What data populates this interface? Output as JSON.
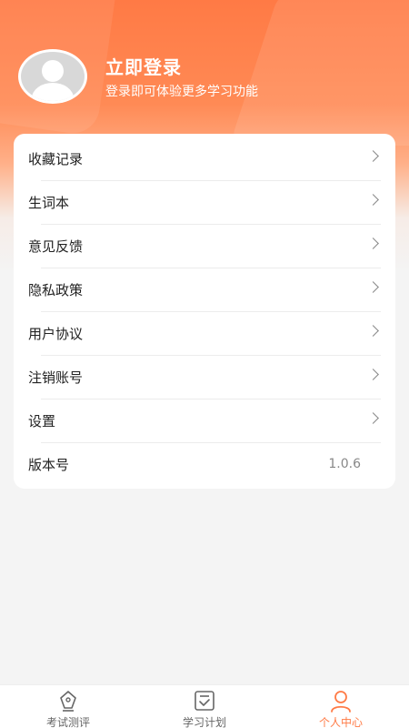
{
  "profile": {
    "login_title": "立即登录",
    "login_subtitle": "登录即可体验更多学习功能"
  },
  "menu": {
    "items": [
      {
        "label": "收藏记录"
      },
      {
        "label": "生词本"
      },
      {
        "label": "意见反馈"
      },
      {
        "label": "隐私政策"
      },
      {
        "label": "用户协议"
      },
      {
        "label": "注销账号"
      },
      {
        "label": "设置"
      }
    ],
    "version_label": "版本号",
    "version_value": "1.0.6"
  },
  "tabbar": {
    "tabs": [
      {
        "label": "考试测评",
        "icon": "pen-icon",
        "active": false
      },
      {
        "label": "学习计划",
        "icon": "checklist-icon",
        "active": false
      },
      {
        "label": "个人中心",
        "icon": "user-icon",
        "active": true
      }
    ]
  },
  "colors": {
    "accent": "#ff7a45",
    "background": "#f4f4f4"
  }
}
